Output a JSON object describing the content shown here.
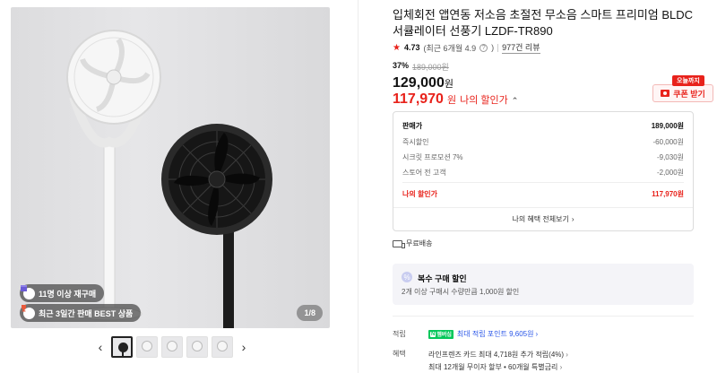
{
  "gallery": {
    "badges": [
      {
        "icon": "box-icon",
        "label": "11명 이상 재구매"
      },
      {
        "icon": "trophy-icon",
        "label": "최근 3일간 판매 BEST 상품"
      }
    ],
    "counter": "1/8",
    "prev": "‹",
    "next": "›"
  },
  "product": {
    "title": "입체회전 앱연동 저소음 초절전 무소음 스마트 프리미엄 BLDC 서큘레이터 선풍기 LZDF-TR890",
    "rating": "4.73",
    "rating_note": "(최근 6개월 4.9",
    "rating_note_close": ")",
    "reviews": "977건 리뷰"
  },
  "price": {
    "discount_rate": "37%",
    "original": "189,000원",
    "sale_amount": "129,000",
    "unit": "원",
    "my_amount": "117,970",
    "my_label": "나의 할인가",
    "coupon_tag": "오늘까지",
    "coupon_button": "쿠폰 받기"
  },
  "breakdown": {
    "rows": [
      {
        "label": "판매가",
        "value": "189,000원"
      },
      {
        "label": "즉시할인",
        "value": "-60,000원"
      },
      {
        "label": "시크릿 프로모션 7%",
        "value": "-9,030원"
      },
      {
        "label": "스토어 전 고객",
        "value": "-2,000원"
      }
    ],
    "my_price_label": "나의 할인가",
    "my_price_value": "117,970원",
    "footer": "나의 혜택 전체보기"
  },
  "delivery": "무료배송",
  "multi_purchase": {
    "title": "복수 구매 할인",
    "desc": "2개 이상 구매시 수량만큼 1,000원 할인"
  },
  "benefits": {
    "accum_label": "적립",
    "np_text": "멤버십",
    "accum_value": "최대 적립 포인트 9,605원",
    "benefit_label": "혜택",
    "line1": "라인프렌즈 카드 최대 4,718원 추가 적립(4%)",
    "line2": "최대 12개월 무이자 할부 • 60개월 특별금리"
  }
}
